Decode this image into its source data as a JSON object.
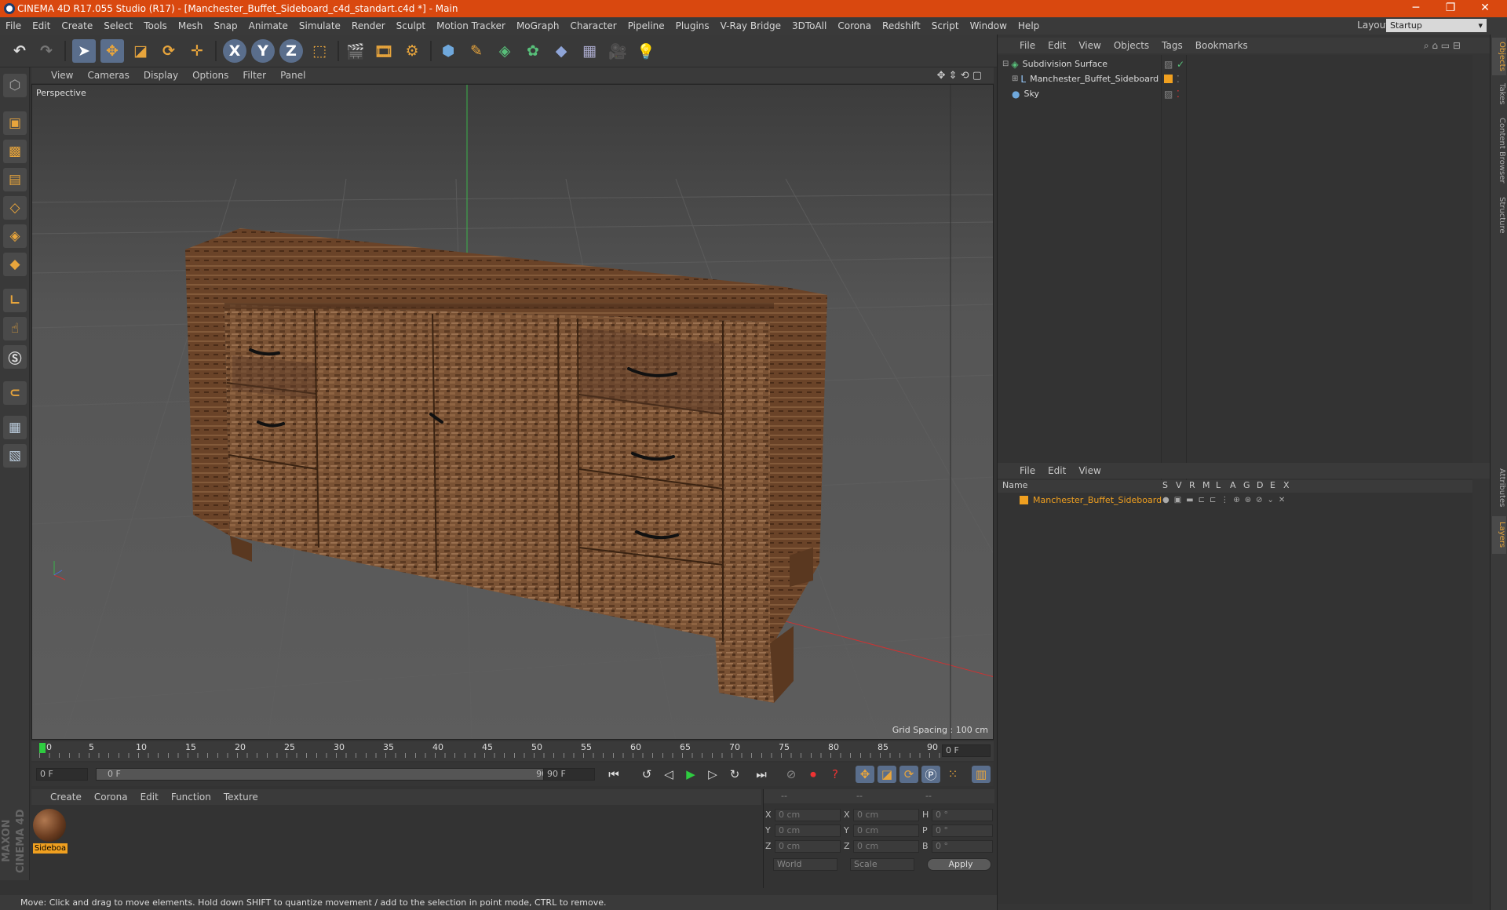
{
  "window": {
    "title": "CINEMA 4D R17.055 Studio (R17) - [Manchester_Buffet_Sideboard_c4d_standart.c4d *] - Main",
    "minimize": "─",
    "maximize": "❐",
    "close": "✕"
  },
  "menu": [
    "File",
    "Edit",
    "Create",
    "Select",
    "Tools",
    "Mesh",
    "Snap",
    "Animate",
    "Simulate",
    "Render",
    "Sculpt",
    "Motion Tracker",
    "MoGraph",
    "Character",
    "Pipeline",
    "Plugins",
    "V-Ray Bridge",
    "3DToAll",
    "Corona",
    "Redshift",
    "Script",
    "Window",
    "Help"
  ],
  "layout": {
    "label": "Layout:",
    "value": "Startup"
  },
  "viewport": {
    "menu": [
      "View",
      "Cameras",
      "Display",
      "Options",
      "Filter",
      "Panel"
    ],
    "label": "Perspective",
    "grid": "Grid Spacing : 100 cm"
  },
  "timeline": {
    "ticks": [
      "0",
      "5",
      "10",
      "15",
      "20",
      "25",
      "30",
      "35",
      "40",
      "45",
      "50",
      "55",
      "60",
      "65",
      "70",
      "75",
      "80",
      "85",
      "90"
    ],
    "current": "0 F"
  },
  "transport": {
    "start": "0 F",
    "range_start": "0 F",
    "range_end": "90 F",
    "end": "90 F"
  },
  "material_menu": [
    "Create",
    "Corona",
    "Edit",
    "Function",
    "Texture"
  ],
  "material": {
    "name": "Sideboa"
  },
  "coords": {
    "header": [
      "--",
      "--",
      "--"
    ],
    "rows": [
      {
        "a": "X",
        "av": "0 cm",
        "b": "X",
        "bv": "0 cm",
        "c": "H",
        "cv": "0 °"
      },
      {
        "a": "Y",
        "av": "0 cm",
        "b": "Y",
        "bv": "0 cm",
        "c": "P",
        "cv": "0 °"
      },
      {
        "a": "Z",
        "av": "0 cm",
        "b": "Z",
        "bv": "0 cm",
        "c": "B",
        "cv": "0 °"
      }
    ],
    "world": "World",
    "scale": "Scale",
    "apply": "Apply"
  },
  "status": "Move: Click and drag to move elements. Hold down SHIFT to quantize movement / add to the selection in point mode, CTRL to remove.",
  "objects": {
    "menu": [
      "File",
      "Edit",
      "View",
      "Objects",
      "Tags",
      "Bookmarks"
    ],
    "items": [
      "Subdivision Surface",
      "Manchester_Buffet_Sideboard",
      "Sky"
    ]
  },
  "layers": {
    "menu": [
      "File",
      "Edit",
      "View"
    ],
    "columns": [
      "Name",
      "S",
      "V",
      "R",
      "M",
      "L",
      "A",
      "G",
      "D",
      "E",
      "X"
    ],
    "item": "Manchester_Buffet_Sideboard"
  },
  "vtabs": [
    "Objects",
    "Takes",
    "Content Browser",
    "Structure",
    "Attributes",
    "Layers"
  ],
  "brand": "MAXON CINEMA 4D",
  "colors": {
    "title": "#d9480f",
    "accent": "#e8a53c",
    "select": "#f0a020"
  }
}
